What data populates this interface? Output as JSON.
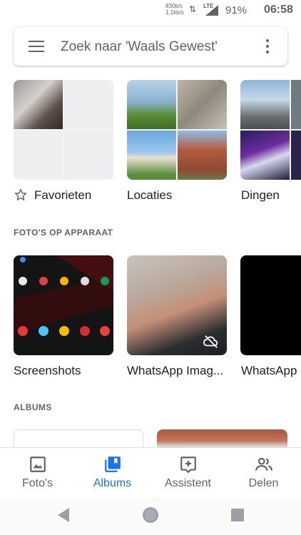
{
  "status_bar": {
    "net_speed_up": "830b/s",
    "net_speed_down": "1,1kb/s",
    "network_type": "LTE",
    "battery": "91%",
    "time": "06:58"
  },
  "search": {
    "placeholder": "Zoek naar 'Waals Gewest'"
  },
  "top_cards": [
    {
      "label": "Favorieten"
    },
    {
      "label": "Locaties"
    },
    {
      "label": "Dingen"
    }
  ],
  "sections": {
    "device_folders_title": "FOTO'S OP APPARAAT",
    "albums_title": "ALBUMS"
  },
  "device_folders": [
    {
      "label": "Screenshots"
    },
    {
      "label": "WhatsApp Imag..."
    },
    {
      "label": "WhatsApp"
    }
  ],
  "bottom_nav": {
    "items": [
      {
        "label": "Foto's",
        "icon": "photo-icon",
        "active": false
      },
      {
        "label": "Albums",
        "icon": "albums-icon",
        "active": true
      },
      {
        "label": "Assistent",
        "icon": "assistant-icon",
        "active": false
      },
      {
        "label": "Delen",
        "icon": "people-icon",
        "active": false
      }
    ]
  },
  "colors": {
    "accent": "#1a73e8",
    "icon_grey": "#5f6368",
    "text": "#202124"
  }
}
